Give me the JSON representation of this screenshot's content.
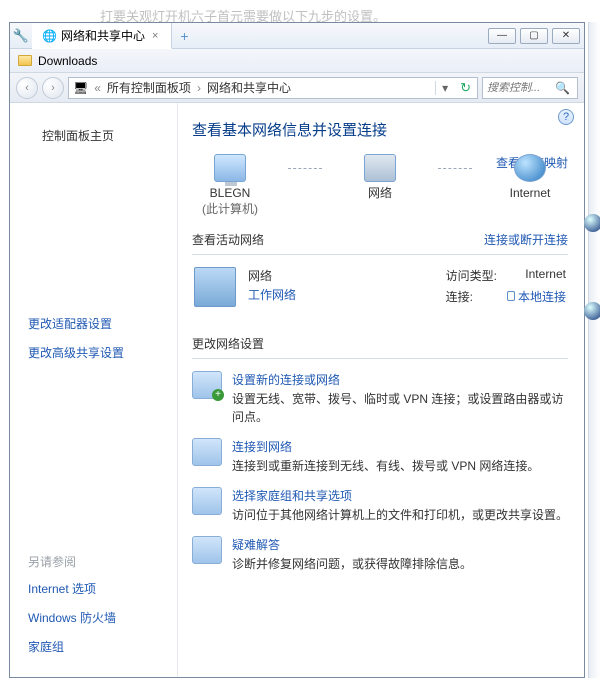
{
  "bg_text": "打要关观灯开机六子首元需要做以下九步的设置。",
  "titlebar": {
    "tab_title": "网络和共享中心",
    "min": "—",
    "max": "▢",
    "close": "✕",
    "add": "+"
  },
  "downloads_bar": {
    "label": "Downloads"
  },
  "navbar": {
    "crumb_icon": "⚙",
    "crumb1": "所有控制面板项",
    "crumb2": "网络和共享中心",
    "search_placeholder": "搜索控制...",
    "back": "‹",
    "fwd": "›",
    "drop": "▾",
    "refresh": "↻",
    "arr": "›",
    "sep": "«"
  },
  "sidebar": {
    "main": "控制面板主页",
    "adapter": "更改适配器设置",
    "advanced": "更改高级共享设置",
    "see_also": "另请参阅",
    "inetopt": "Internet 选项",
    "firewall": "Windows 防火墙",
    "homegroup": "家庭组"
  },
  "main": {
    "heading": "查看基本网络信息并设置连接",
    "full_map": "查看完整映射",
    "node_computer": "BLEGN",
    "node_computer_sub": "(此计算机)",
    "node_network": "网络",
    "node_internet": "Internet",
    "active_title": "查看活动网络",
    "connect_link": "连接或断开连接",
    "net_name": "网络",
    "net_type": "工作网络",
    "access_label": "访问类型:",
    "access_value": "Internet",
    "conn_label": "连接:",
    "conn_value": "本地连接",
    "change_title": "更改网络设置",
    "tasks": [
      {
        "title": "设置新的连接或网络",
        "desc": "设置无线、宽带、拨号、临时或 VPN 连接；或设置路由器或访问点。"
      },
      {
        "title": "连接到网络",
        "desc": "连接到或重新连接到无线、有线、拨号或 VPN 网络连接。"
      },
      {
        "title": "选择家庭组和共享选项",
        "desc": "访问位于其他网络计算机上的文件和打印机，或更改共享设置。"
      },
      {
        "title": "疑难解答",
        "desc": "诊断并修复网络问题，或获得故障排除信息。"
      }
    ]
  }
}
